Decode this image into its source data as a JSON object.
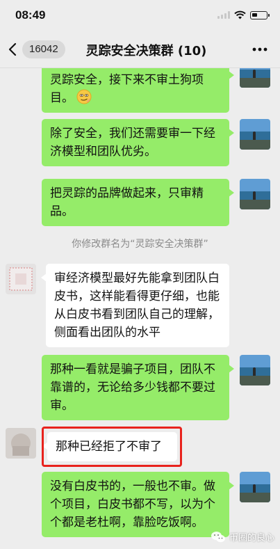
{
  "status": {
    "time": "08:49"
  },
  "header": {
    "unread": "16042",
    "title": "灵踪安全决策群 (10)"
  },
  "messages": [
    {
      "side": "right",
      "text": "灵踪安全，接下来不审土狗项目。"
    },
    {
      "side": "right",
      "text": "除了安全，我们还需要审一下经济模型和团队优劣。"
    },
    {
      "side": "right",
      "text": "把灵踪的品牌做起来，只审精品。"
    },
    {
      "side": "left",
      "text": "审经济模型最好先能拿到团队白皮书，这样能看得更仔细，也能从白皮书看到团队自己的理解，侧面看出团队的水平"
    },
    {
      "side": "right",
      "text": "那种一看就是骗子项目，团队不靠谱的，无论给多少钱都不要过审。"
    },
    {
      "side": "left",
      "text": "那种已经拒了不审了"
    },
    {
      "side": "right",
      "text": "没有白皮书的，一般也不审。做个项目，白皮书都不写，以为个个都是老杜啊，靠脸吃饭啊。"
    }
  ],
  "system_message": "你修改群名为“灵踪安全决策群”",
  "watermark": "币圈的良心",
  "colors": {
    "bubble_self": "#95ec69",
    "bubble_other": "#ffffff",
    "background": "#ededed",
    "highlight": "#e8231d"
  },
  "icons": [
    "back-icon",
    "more-icon",
    "signal-icon",
    "wifi-icon",
    "battery-icon",
    "emoji-icon",
    "wechat-watermark-icon"
  ]
}
